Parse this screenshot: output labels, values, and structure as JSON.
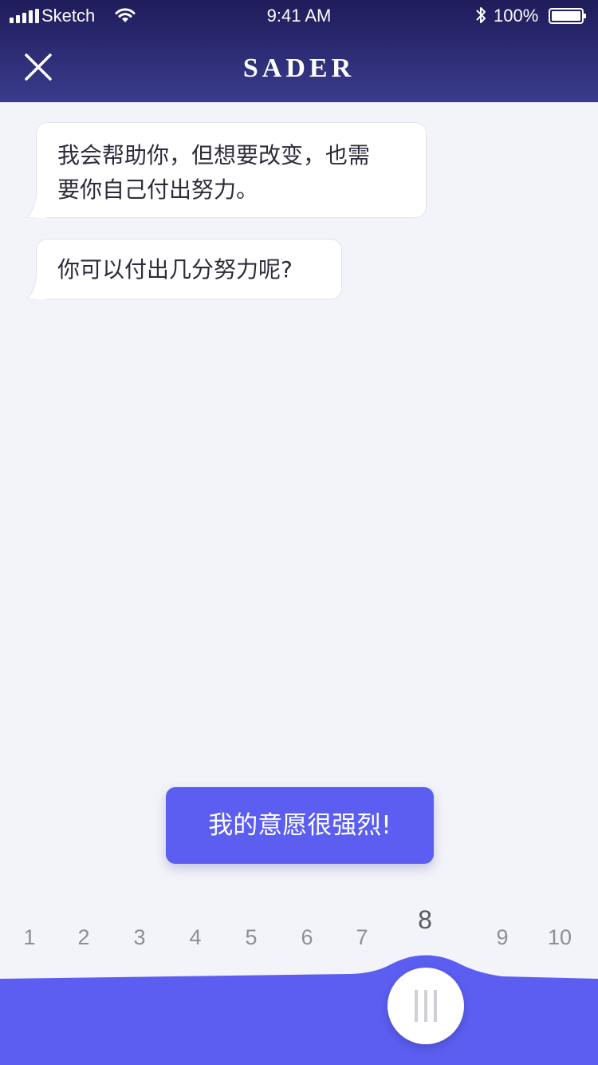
{
  "status_bar": {
    "carrier": "Sketch",
    "time": "9:41 AM",
    "battery": "100%"
  },
  "header": {
    "title": "SADER",
    "close_icon": "close-icon"
  },
  "messages": [
    {
      "text_line1": "我会帮助你，但想要改变，也需",
      "text_line2": "要你自己付出努力。"
    },
    {
      "text": "你可以付出几分努力呢?"
    }
  ],
  "answer": {
    "label": "我的意愿很强烈!"
  },
  "scale": {
    "numbers": [
      "1",
      "2",
      "3",
      "4",
      "5",
      "6",
      "7",
      "8",
      "9",
      "10"
    ],
    "selected_value": 8,
    "selected_label": "8"
  },
  "colors": {
    "header_top": "#1f1c5a",
    "header_bottom": "#3a3b8e",
    "accent": "#5b5ef0",
    "background": "#f3f4f9"
  }
}
